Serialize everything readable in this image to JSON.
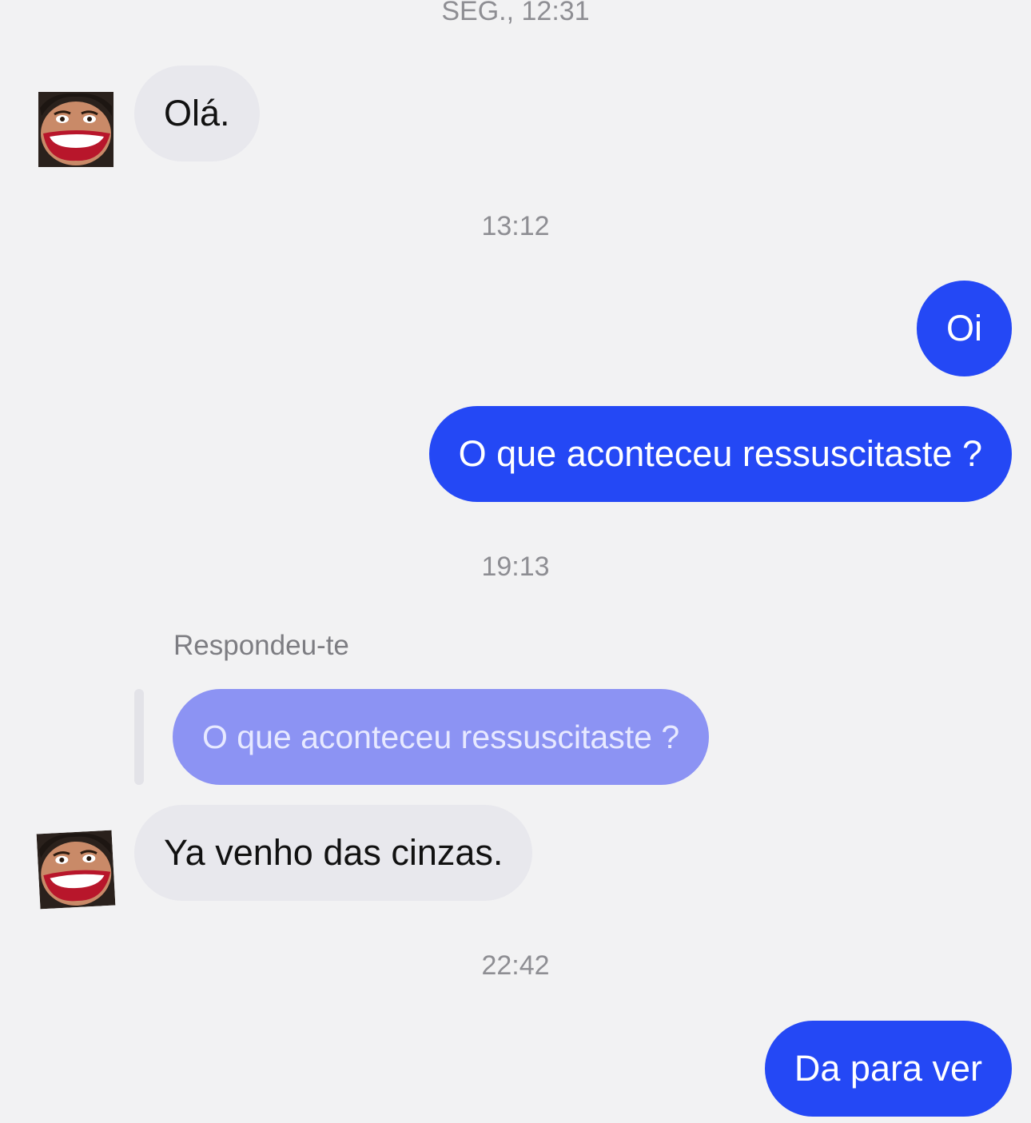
{
  "colors": {
    "background": "#f2f2f3",
    "incoming_bubble": "#e8e8ed",
    "outgoing_bubble": "#2448f5",
    "quoted_bubble": "#8c93f3",
    "timestamp_text": "#8e8e93"
  },
  "conversation": {
    "timestamps": [
      "SEG., 12:31",
      "13:12",
      "19:13",
      "22:42"
    ],
    "messages": [
      {
        "direction": "incoming",
        "avatar": "contact-avatar",
        "text": "Olá."
      },
      {
        "direction": "outgoing",
        "text": "Oi"
      },
      {
        "direction": "outgoing",
        "text": "O que aconteceu ressuscitaste ?"
      },
      {
        "direction": "incoming",
        "reply_label": "Respondeu-te",
        "quoted_text": "O que aconteceu ressuscitaste ?",
        "avatar": "contact-avatar",
        "text": "Ya venho das cinzas."
      },
      {
        "direction": "outgoing",
        "text": "Da para ver"
      }
    ]
  }
}
